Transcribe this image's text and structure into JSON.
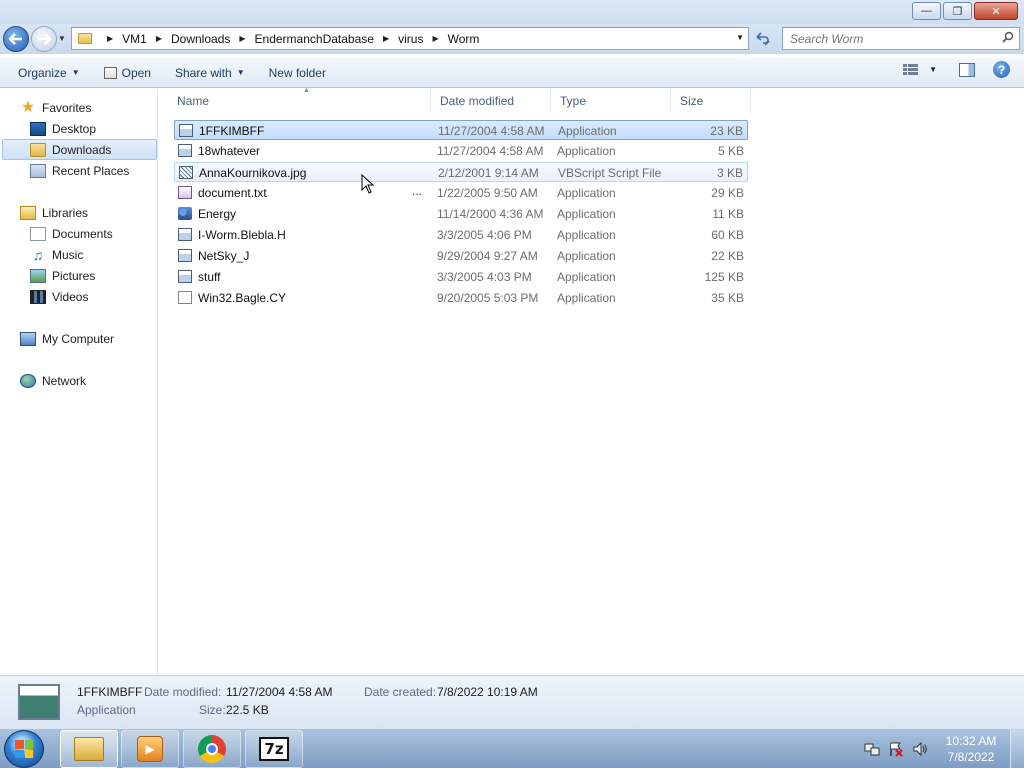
{
  "window": {
    "minimize_glyph": "—",
    "maximize_glyph": "❐",
    "close_glyph": "✕"
  },
  "address": {
    "breadcrumbs": [
      "VM1",
      "Downloads",
      "EndermanchDatabase",
      "virus",
      "Worm"
    ],
    "search_placeholder": "Search Worm"
  },
  "toolbar": {
    "organize": "Organize",
    "open": "Open",
    "share_with": "Share with",
    "new_folder": "New folder"
  },
  "nav": {
    "favorites": "Favorites",
    "desktop": "Desktop",
    "downloads": "Downloads",
    "recent_places": "Recent Places",
    "libraries": "Libraries",
    "documents": "Documents",
    "music": "Music",
    "pictures": "Pictures",
    "videos": "Videos",
    "my_computer": "My Computer",
    "network": "Network"
  },
  "columns": {
    "name": "Name",
    "date_modified": "Date modified",
    "type": "Type",
    "size": "Size"
  },
  "files": [
    {
      "name": "1FFKIMBFF",
      "date": "11/27/2004 4:58 AM",
      "type": "Application",
      "size": "23 KB",
      "icon": "application-icon"
    },
    {
      "name": "18whatever",
      "date": "11/27/2004 4:58 AM",
      "type": "Application",
      "size": "5 KB",
      "icon": "application-icon"
    },
    {
      "name": "AnnaKournikova.jpg",
      "date": "2/12/2001 9:14 AM",
      "type": "VBScript Script File",
      "size": "3 KB",
      "icon": "vbscript-icon"
    },
    {
      "name": "document.txt",
      "date": "1/22/2005 9:50 AM",
      "type": "Application",
      "size": "29 KB",
      "icon": "text-app-icon",
      "extra": "..."
    },
    {
      "name": "Energy",
      "date": "11/14/2000 4:36 AM",
      "type": "Application",
      "size": "11 KB",
      "icon": "energy-app-icon"
    },
    {
      "name": "I-Worm.Blebla.H",
      "date": "3/3/2005 4:06 PM",
      "type": "Application",
      "size": "60 KB",
      "icon": "application-icon"
    },
    {
      "name": "NetSky_J",
      "date": "9/29/2004 9:27 AM",
      "type": "Application",
      "size": "22 KB",
      "icon": "application-icon"
    },
    {
      "name": "stuff",
      "date": "3/3/2005 4:03 PM",
      "type": "Application",
      "size": "125 KB",
      "icon": "application-icon"
    },
    {
      "name": "Win32.Bagle.CY",
      "date": "9/20/2005 5:03 PM",
      "type": "Application",
      "size": "35 KB",
      "icon": "document-app-icon"
    }
  ],
  "details": {
    "name": "1FFKIMBFF",
    "type": "Application",
    "date_modified_label": "Date modified:",
    "date_modified": "11/27/2004 4:58 AM",
    "date_created_label": "Date created:",
    "date_created": "7/8/2022 10:19 AM",
    "size_label": "Size:",
    "size": "22.5 KB"
  },
  "taskbar": {
    "seven_zip_label": "7z",
    "time": "10:32 AM",
    "date": "7/8/2022"
  }
}
